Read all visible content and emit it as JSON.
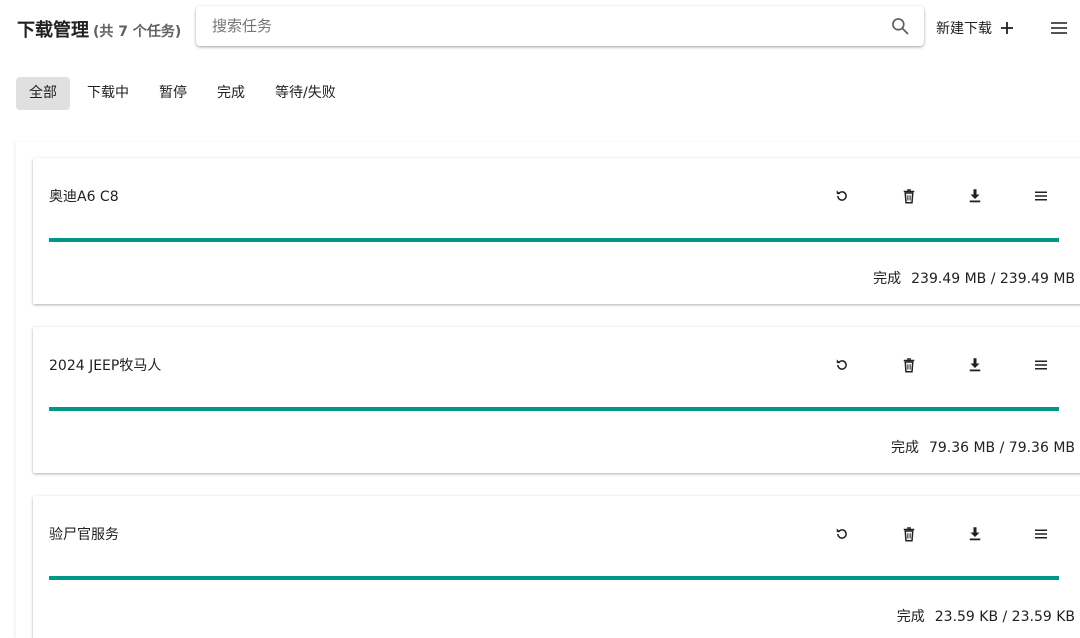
{
  "header": {
    "title": "下载管理",
    "count_text": "(共 7 个任务)",
    "search_placeholder": "搜索任务",
    "new_download_label": "新建下载"
  },
  "tabs": [
    {
      "label": "全部",
      "active": true
    },
    {
      "label": "下载中",
      "active": false
    },
    {
      "label": "暂停",
      "active": false
    },
    {
      "label": "完成",
      "active": false
    },
    {
      "label": "等待/失败",
      "active": false
    }
  ],
  "tasks": [
    {
      "name": "奥迪A6 C8",
      "status": "完成",
      "size": "239.49 MB / 239.49 MB",
      "progress": 1.0
    },
    {
      "name": "2024 JEEP牧马人",
      "status": "完成",
      "size": "79.36 MB / 79.36 MB",
      "progress": 1.0
    },
    {
      "name": "验尸官服务",
      "status": "完成",
      "size": "23.59 KB / 23.59 KB",
      "progress": 1.0
    }
  ],
  "colors": {
    "accent": "#009688",
    "progress_track": "#b2dfdb",
    "tab_active_bg": "#e0e0e0"
  },
  "icons": {
    "search": "search-icon",
    "add": "plus-icon",
    "menu": "menu-icon",
    "retry": "refresh-icon",
    "delete": "trash-icon",
    "download": "download-icon",
    "more": "menu-icon"
  }
}
